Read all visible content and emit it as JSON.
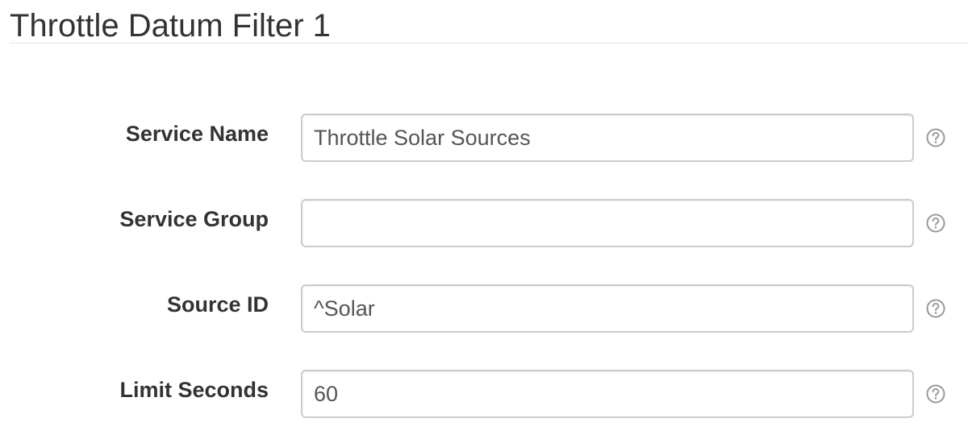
{
  "page": {
    "title": "Throttle Datum Filter 1"
  },
  "form": {
    "fields": [
      {
        "label": "Service Name",
        "value": "Throttle Solar Sources",
        "icon": "question-circle-icon"
      },
      {
        "label": "Service Group",
        "value": "",
        "icon": "question-circle-icon"
      },
      {
        "label": "Source ID",
        "value": "^Solar",
        "icon": "question-circle-icon"
      },
      {
        "label": "Limit Seconds",
        "value": "60",
        "icon": "question-circle-icon"
      }
    ]
  },
  "colors": {
    "text": "#333333",
    "input_border": "#cccccc",
    "help_icon": "#999999"
  }
}
